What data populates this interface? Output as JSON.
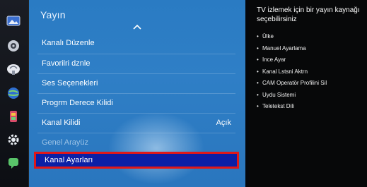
{
  "rail": {
    "icons": [
      "picture-icon",
      "sound-icon",
      "broadcast-icon",
      "network-icon",
      "system-icon",
      "settings-gear-icon",
      "support-icon"
    ]
  },
  "menu": {
    "title": "Yayın",
    "items": [
      {
        "label": "Kanalı Düzenle",
        "value": ""
      },
      {
        "label": "Favorilri dznle",
        "value": ""
      },
      {
        "label": "Ses Seçenekleri",
        "value": ""
      },
      {
        "label": "Progrm Derece Kilidi",
        "value": ""
      },
      {
        "label": "Kanal Kilidi",
        "value": "Açık"
      },
      {
        "label": "Genel Arayüz",
        "value": ""
      },
      {
        "label": "Kanal Ayarları",
        "value": ""
      }
    ]
  },
  "help": {
    "title": "TV izlemek için bir yayın kaynağı seçebilirsiniz",
    "items": [
      "Ülke",
      "Manuel Ayarlama",
      "Ince Ayar",
      "Kanal Lstsni Aktrn",
      "CAM Operatör Profilini Sil",
      "Uydu Sistemi",
      "Teletekst Dili"
    ]
  },
  "colors": {
    "panel": "#2f7fc6",
    "selected_bg": "#0b1fa6",
    "highlight_border": "#e01818"
  }
}
